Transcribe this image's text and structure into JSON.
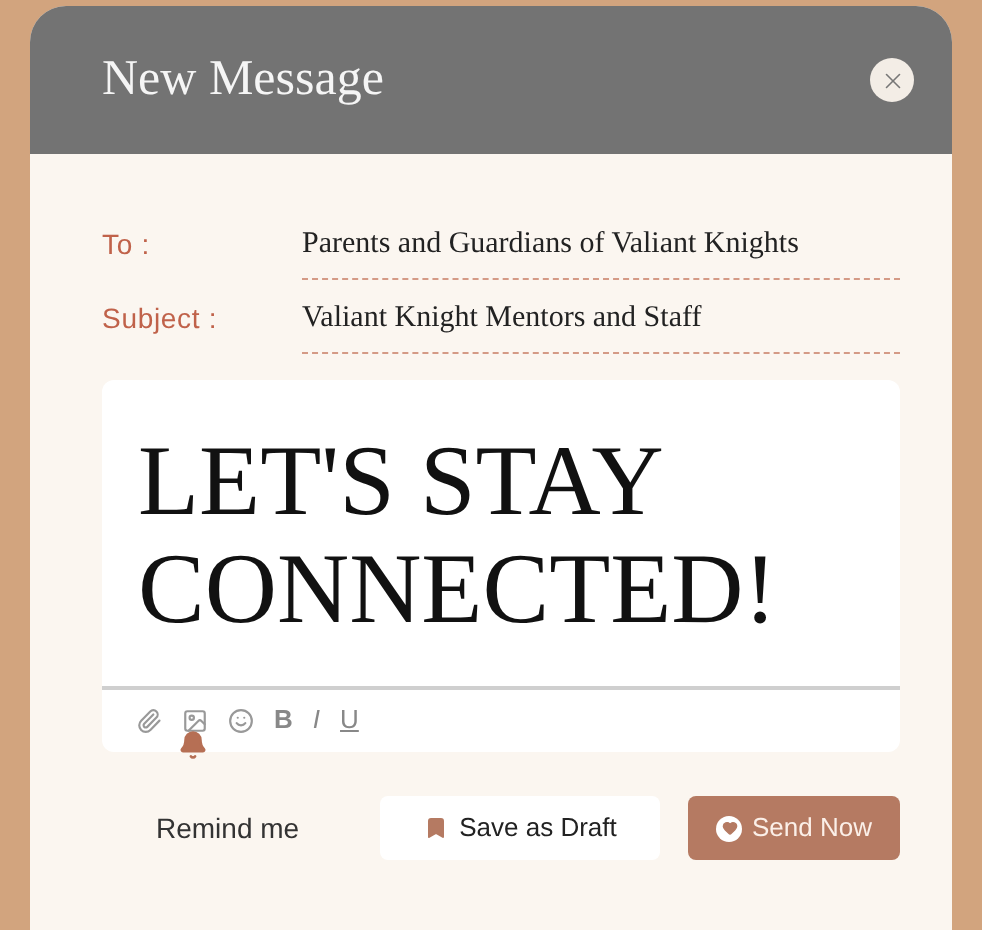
{
  "window": {
    "title": "New Message"
  },
  "fields": [
    {
      "label": "To :",
      "value": "Parents and Guardians of Valiant Knights"
    },
    {
      "label": "Subject :",
      "value": "Valiant Knight Mentors and Staff"
    }
  ],
  "body": "LET'S STAY CONNECTED!",
  "toolbar": [
    {
      "kind": "attach"
    },
    {
      "kind": "image"
    },
    {
      "kind": "emoji"
    },
    {
      "kind": "text",
      "label": "B"
    },
    {
      "kind": "text",
      "label": "I"
    },
    {
      "kind": "text",
      "label": "U"
    }
  ],
  "actions": {
    "remind": "Remind me",
    "draft": "Save as Draft",
    "send": "Send Now"
  }
}
